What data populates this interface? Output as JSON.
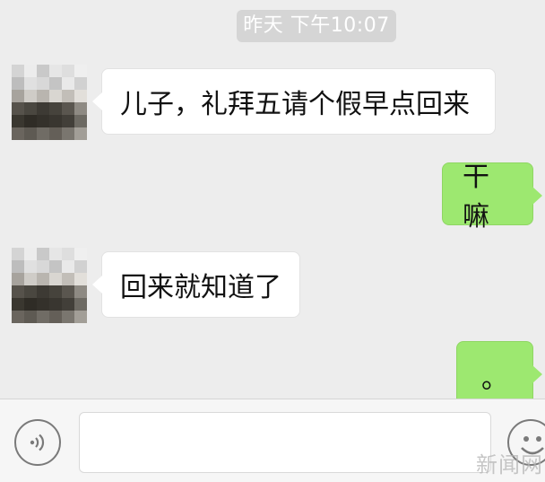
{
  "timestamp": "昨天 下午10:07",
  "messages": [
    {
      "side": "left",
      "text": "儿子，礼拜五请个假早点回来"
    },
    {
      "side": "right",
      "text": "干嘛"
    },
    {
      "side": "left",
      "text": "回来就知道了"
    },
    {
      "side": "right",
      "text": "。"
    }
  ],
  "input_bar": {
    "text_value": "",
    "voice_icon": "voice-icon",
    "emoji_icon": "emoji-icon"
  },
  "watermark": "新闻网",
  "colors": {
    "background": "#ededed",
    "sent_bubble": "#9de870",
    "received_bubble": "#ffffff",
    "timestamp_bg": "#d5d5d5"
  }
}
